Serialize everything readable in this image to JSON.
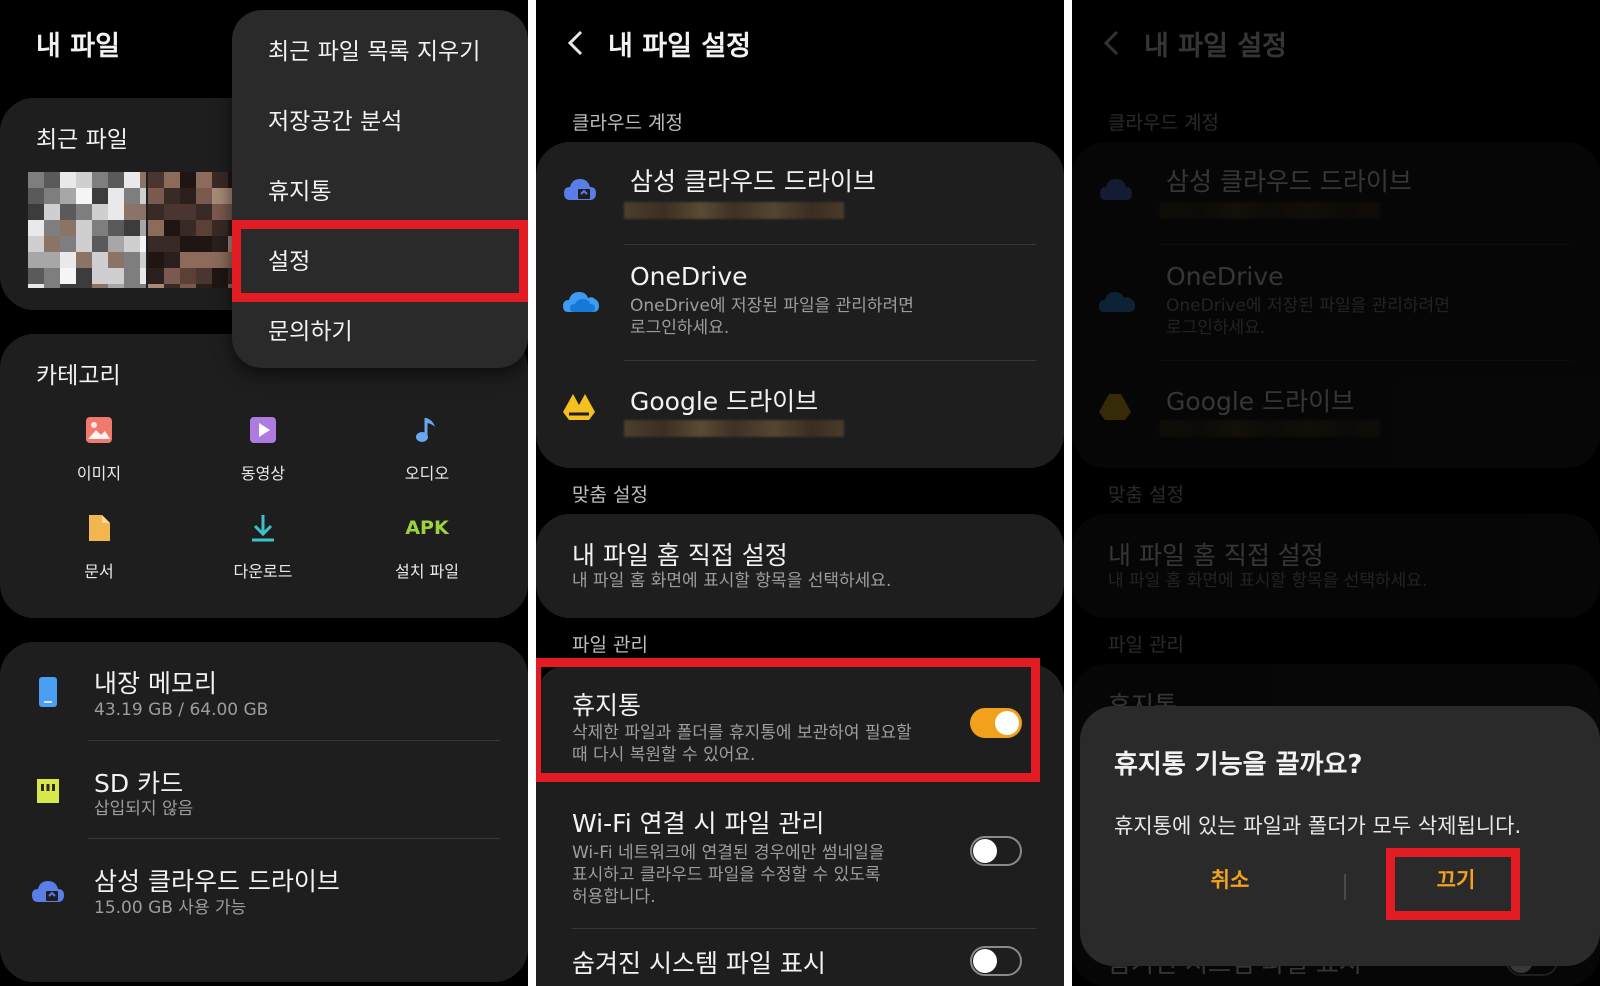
{
  "panel_left": {
    "app_title": "내 파일",
    "recent_files_title": "최근 파일",
    "categories_title": "카테고리",
    "categories": [
      {
        "label": "이미지",
        "icon": "image-icon"
      },
      {
        "label": "동영상",
        "icon": "video-icon"
      },
      {
        "label": "오디오",
        "icon": "audio-icon"
      },
      {
        "label": "문서",
        "icon": "document-icon"
      },
      {
        "label": "다운로드",
        "icon": "download-icon"
      },
      {
        "label": "설치 파일",
        "icon": "apk-icon",
        "icon_text": "APK"
      }
    ],
    "storage": [
      {
        "name": "내장 메모리",
        "detail": "43.19 GB / 64.00 GB",
        "icon": "phone-icon"
      },
      {
        "name": "SD 카드",
        "detail": "삽입되지 않음",
        "icon": "sd-card-icon"
      },
      {
        "name": "삼성 클라우드 드라이브",
        "detail": "15.00 GB 사용 가능",
        "icon": "samsung-cloud-icon"
      }
    ],
    "menu_items": [
      "최근 파일 목록 지우기",
      "저장공간 분석",
      "휴지통",
      "설정",
      "문의하기"
    ],
    "highlighted_menu_item": "설정"
  },
  "settings": {
    "title": "내 파일 설정",
    "cloud_section": "클라우드 계정",
    "cloud_accounts": [
      {
        "name": "삼성 클라우드 드라이브",
        "detail": "",
        "icon": "samsung-cloud-icon"
      },
      {
        "name": "OneDrive",
        "detail_line1": "OneDrive에 저장된 파일을 관리하려면",
        "detail_line2": "로그인하세요.",
        "icon": "onedrive-icon"
      },
      {
        "name": "Google 드라이브",
        "detail": "",
        "icon": "google-drive-icon"
      }
    ],
    "custom_section": "맞춤 설정",
    "home_custom": {
      "title": "내 파일 홈 직접 설정",
      "detail": "내 파일 홈 화면에 표시할 항목을 선택하세요."
    },
    "file_section": "파일 관리",
    "trash": {
      "title": "휴지통",
      "detail_line1": "삭제한 파일과 폴더를 휴지통에 보관하여 필요할",
      "detail_line2": "때 다시 복원할 수 있어요.",
      "enabled": true
    },
    "wifi": {
      "title": "Wi-Fi 연결 시 파일 관리",
      "detail_line1": "Wi-Fi 네트워크에 연결된 경우에만 썸네일을",
      "detail_line2": "표시하고 클라우드 파일을 수정할 수 있도록",
      "detail_line3": "허용합니다.",
      "enabled": false
    },
    "hidden_files": {
      "title": "숨겨진 시스템 파일 표시",
      "enabled": false
    },
    "trash_row_partial": "휴지통"
  },
  "dialog": {
    "title": "휴지통 기능을 끌까요?",
    "message": "휴지통에 있는 파일과 폴더가 모두 삭제됩니다.",
    "cancel_label": "취소",
    "confirm_label": "끄기"
  },
  "colors": {
    "background": "#000000",
    "card": "#1e1e1e",
    "menu": "#2a2a2a",
    "highlight": "#e31b23",
    "accent": "#f2a11c"
  }
}
